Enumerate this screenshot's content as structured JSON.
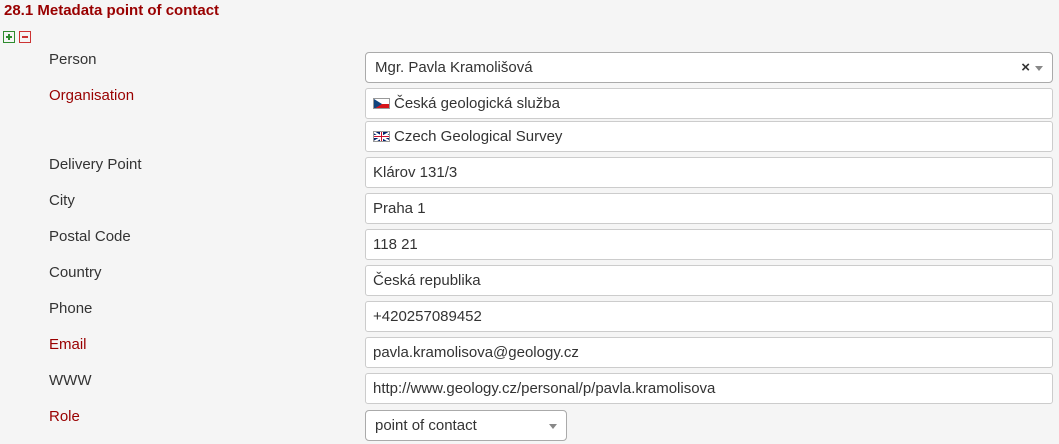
{
  "section": {
    "title": "28.1 Metadata point of contact"
  },
  "controls": {
    "add_icon": "plus-square-icon",
    "remove_icon": "minus-square-icon"
  },
  "colors": {
    "required_label": "#990000",
    "add": "#2e8b2e",
    "remove": "#cc3333"
  },
  "fields": {
    "person": {
      "label": "Person",
      "value": "Mgr. Pavla Kramolišová",
      "clear": "×"
    },
    "organisation": {
      "label": "Organisation",
      "values": [
        {
          "flag": "czech-flag-icon",
          "text": "Česká geologická služba"
        },
        {
          "flag": "uk-flag-icon",
          "text": "Czech Geological Survey"
        }
      ]
    },
    "delivery_point": {
      "label": "Delivery Point",
      "value": "Klárov 131/3"
    },
    "city": {
      "label": "City",
      "value": "Praha 1"
    },
    "postal_code": {
      "label": "Postal Code",
      "value": "118 21"
    },
    "country": {
      "label": "Country",
      "value": "Česká republika"
    },
    "phone": {
      "label": "Phone",
      "value": "+420257089452"
    },
    "email": {
      "label": "Email",
      "value": "pavla.kramolisova@geology.cz"
    },
    "www": {
      "label": "WWW",
      "value": "http://www.geology.cz/personal/p/pavla.kramolisova"
    },
    "role": {
      "label": "Role",
      "value": "point of contact"
    }
  }
}
